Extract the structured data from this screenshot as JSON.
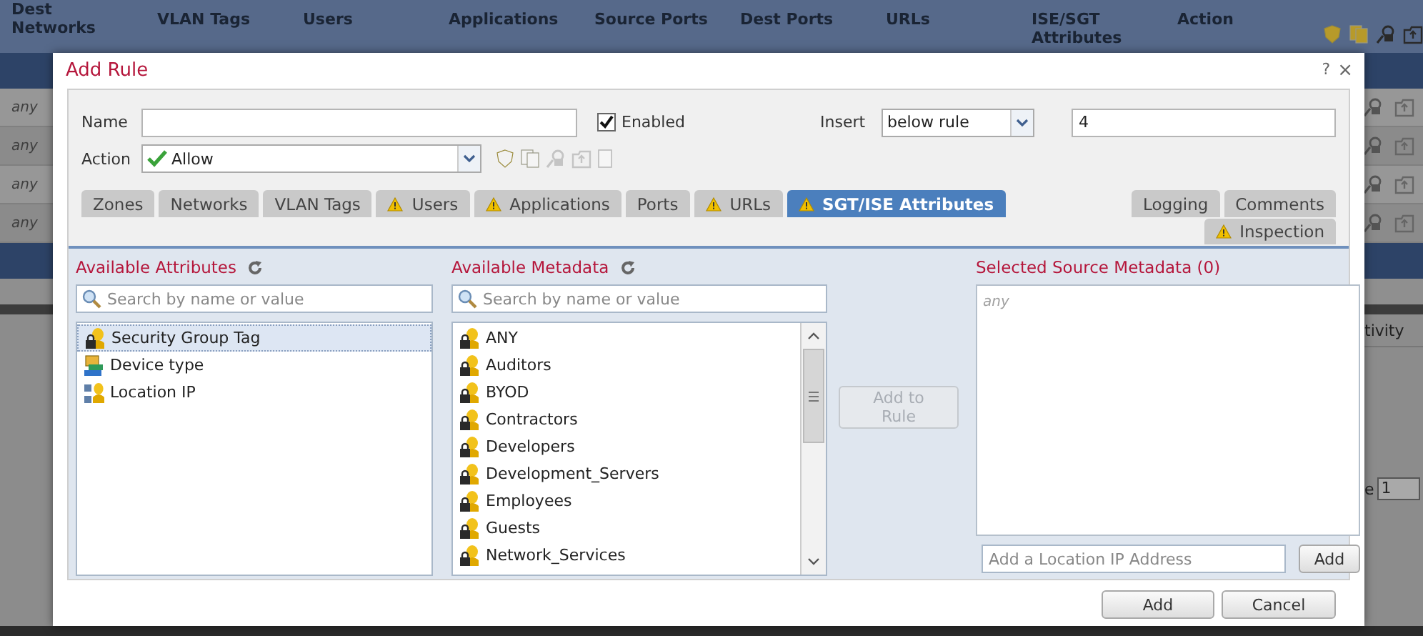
{
  "page": {
    "columns": [
      "Dest Networks",
      "VLAN Tags",
      "Users",
      "Applications",
      "Source Ports",
      "Dest Ports",
      "URLs",
      "ISE/SGT Attributes",
      "Action"
    ],
    "rows": [
      {
        "cell": "any"
      },
      {
        "cell": "any"
      },
      {
        "cell": "any"
      },
      {
        "cell": "any"
      }
    ],
    "side_column": "tivity",
    "page_label": "e",
    "page_field": "1"
  },
  "dialog": {
    "title": "Add Rule",
    "help": "?",
    "close": "×",
    "name_label": "Name",
    "enabled": {
      "label": "Enabled",
      "checked": true
    },
    "insert_label": "Insert",
    "insert_value": "below rule",
    "rule_number": "4",
    "action_label": "Action",
    "action_value": "Allow",
    "tabs": [
      {
        "label": "Zones",
        "warning": false,
        "selected": false
      },
      {
        "label": "Networks",
        "warning": false,
        "selected": false
      },
      {
        "label": "VLAN Tags",
        "warning": false,
        "selected": false
      },
      {
        "label": "Users",
        "warning": true,
        "selected": false
      },
      {
        "label": "Applications",
        "warning": true,
        "selected": false
      },
      {
        "label": "Ports",
        "warning": false,
        "selected": false
      },
      {
        "label": "URLs",
        "warning": true,
        "selected": false
      },
      {
        "label": "SGT/ISE Attributes",
        "warning": true,
        "selected": true
      }
    ],
    "side_tabs": [
      {
        "label": "Logging",
        "warning": false,
        "selected": false
      },
      {
        "label": "Comments",
        "warning": false,
        "selected": false
      },
      {
        "label": "Inspection",
        "warning": true,
        "selected": false
      }
    ],
    "attributes": {
      "title": "Available Attributes",
      "placeholder": "Search by name or value",
      "items": [
        {
          "label": "Security Group Tag",
          "kind": "tag",
          "selected": true
        },
        {
          "label": "Device type",
          "kind": "device",
          "selected": false
        },
        {
          "label": "Location IP",
          "kind": "location",
          "selected": false
        }
      ]
    },
    "metadata": {
      "title": "Available Metadata",
      "placeholder": "Search by name or value",
      "items": [
        {
          "label": "ANY",
          "selected": false
        },
        {
          "label": "Auditors",
          "selected": false
        },
        {
          "label": "BYOD",
          "selected": false
        },
        {
          "label": "Contractors",
          "selected": false
        },
        {
          "label": "Developers",
          "selected": false
        },
        {
          "label": "Development_Servers",
          "selected": false
        },
        {
          "label": "Employees",
          "selected": false
        },
        {
          "label": "Guests",
          "selected": false
        },
        {
          "label": "Network_Services",
          "selected": false
        }
      ]
    },
    "add_to_rule": {
      "label": "Add to Rule",
      "disabled": true
    },
    "selected_metadata": {
      "title": "Selected Source Metadata (0)",
      "empty_text": "any",
      "ip_placeholder": "Add a Location IP Address",
      "add_label": "Add"
    },
    "buttons": [
      "Add",
      "Cancel"
    ]
  }
}
